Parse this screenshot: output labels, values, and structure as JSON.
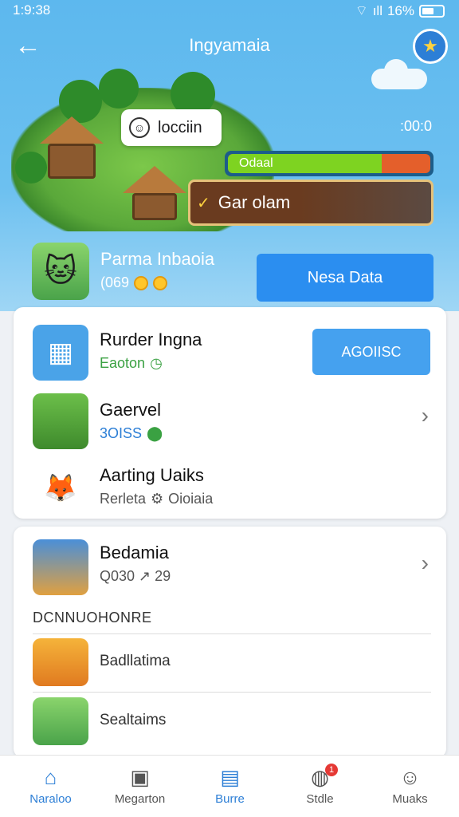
{
  "status": {
    "time": "1:9:38",
    "battery": "16%",
    "signal": "ıll"
  },
  "header": {
    "title": "Ingyamaia"
  },
  "scene": {
    "bubble_text": "locciin",
    "timer": ":00:0",
    "progress_label": "Odaal",
    "progress_value": 0.76,
    "banner_text": "Gar olam"
  },
  "profile": {
    "name": "Parma Inbaoia",
    "sub": "(069",
    "new_button": "Nesa Data"
  },
  "card1": {
    "items": [
      {
        "title": "Rurder Ingna",
        "sub": "Eaoton",
        "button": "AGOIISC"
      },
      {
        "title": "Gaervel",
        "sub": "3OISS"
      },
      {
        "title": "Aarting Uaiks",
        "sub": "Rerleta",
        "sub2": "Oioiaia"
      }
    ]
  },
  "card2": {
    "top_item": {
      "title": "Bedamia",
      "sub": "Q030 ↗ 29"
    },
    "section_label": "DCNNUOHONRE",
    "list": [
      {
        "label": "Badllatima"
      },
      {
        "label": "Sealtaims"
      }
    ]
  },
  "tabs": [
    {
      "label": "Naraloo",
      "icon": "home-icon",
      "active": true
    },
    {
      "label": "Megarton",
      "icon": "store-icon",
      "active": false
    },
    {
      "label": "Burre",
      "icon": "bag-icon",
      "active": true
    },
    {
      "label": "Stdle",
      "icon": "notification-icon",
      "badge": "1",
      "active": false
    },
    {
      "label": "Muaks",
      "icon": "profile-icon",
      "active": false
    }
  ]
}
